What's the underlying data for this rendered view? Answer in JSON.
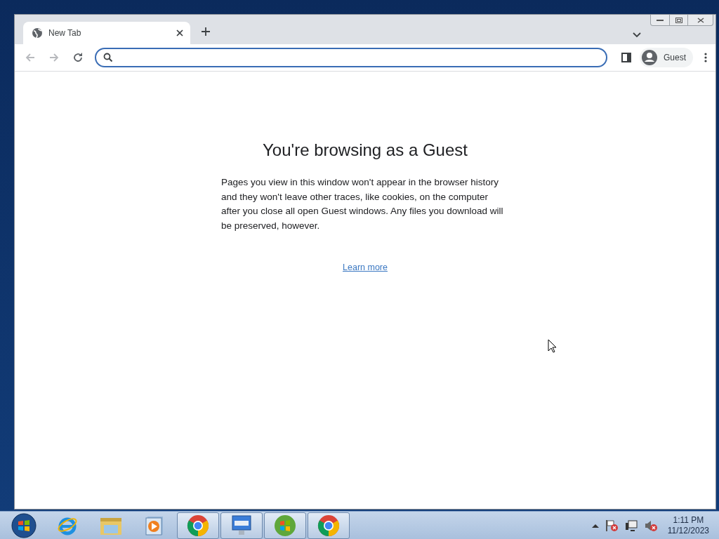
{
  "browser": {
    "tabs": [
      {
        "title": "New Tab",
        "selected": true
      }
    ],
    "nav_buttons": [
      {
        "kind": "back",
        "disabled": true
      },
      {
        "kind": "forward",
        "disabled": true
      },
      {
        "kind": "reload",
        "disabled": false
      }
    ],
    "address_bar": {
      "focused": true
    },
    "profile": {
      "label": "Guest"
    }
  },
  "page": {
    "heading": "You're browsing as a Guest",
    "body": "Pages you view in this window won't appear in the browser history and they won't leave other traces, like cookies, on the computer after you close all open Guest windows. Any files you download will be preserved, however.",
    "link": "Learn more"
  },
  "taskbar": {
    "items": [
      {
        "kind": "start",
        "running": false
      },
      {
        "kind": "ie",
        "running": false
      },
      {
        "kind": "explorer",
        "running": false
      },
      {
        "kind": "media",
        "running": false
      },
      {
        "kind": "chrome",
        "running": true
      },
      {
        "kind": "keyboard",
        "running": true
      },
      {
        "kind": "winlogo",
        "running": true
      },
      {
        "kind": "chrome",
        "running": true
      }
    ],
    "clock": {
      "time": "1:11 PM",
      "date": "11/12/2023"
    }
  }
}
